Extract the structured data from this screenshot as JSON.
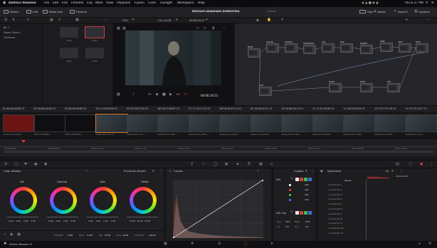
{
  "menubar": {
    "app": "DaVinci Resolve",
    "items": [
      "File",
      "Edit",
      "Trim",
      "Timeline",
      "Clip",
      "Mark",
      "View",
      "Playback",
      "Fusion",
      "Color",
      "Fairlight",
      "Workspace",
      "Help"
    ],
    "clock": "Thu 6:37 PM"
  },
  "toolbar": {
    "gallery": "Gallery",
    "luts": "LUTs",
    "media_pool": "Media Pool",
    "timeline": "Timeline",
    "project_title": "RESOLVE AVANZADO DOMESTIKA",
    "project_status": "Edited",
    "clips": "Clips",
    "nodes": "Nodes",
    "openfx": "OpenFX",
    "lightbox": "Lightbox"
  },
  "subbar": {
    "zoom": "37%",
    "clip_name": "Co1_OLOR",
    "timecode": "00:00:19:21"
  },
  "bins": [
    "Bin 1",
    "Power Grade 1",
    "Timelines"
  ],
  "thumbs": [
    "1401",
    "1401",
    "1401",
    "1401"
  ],
  "viewer": {
    "timecode": "00:00:19:21"
  },
  "nodes": {
    "labels": [
      "BASE",
      "COLOR",
      "CURVAS",
      "CONTRAST",
      "SAT",
      "HUE",
      "RANGE",
      "SKIN",
      "DET",
      "FACE",
      "CLIP",
      "LIGHT",
      "EXPO",
      "WB"
    ]
  },
  "timeline": {
    "clip_codes": [
      {
        "n": "01",
        "tc": "00:00:00:00",
        "tr": "V1"
      },
      {
        "n": "02",
        "tc": "00:00:00:00",
        "tr": "V1"
      },
      {
        "n": "03",
        "tc": "00:00:00:00",
        "tr": "V1"
      },
      {
        "n": "04",
        "tc": "11:20:00:00",
        "tr": "V1"
      },
      {
        "n": "05",
        "tc": "20:59:57:04",
        "tr": "V1"
      },
      {
        "n": "06",
        "tc": "16:27:08:07",
        "tr": "V1"
      },
      {
        "n": "07",
        "tc": "17:10:11:22",
        "tr": "V1"
      },
      {
        "n": "08",
        "tc": "16:45:03:14",
        "tr": "V1"
      },
      {
        "n": "09",
        "tc": "16:28:02:21",
        "tr": "V1"
      },
      {
        "n": "10",
        "tc": "16:46:30:14",
        "tr": "V1"
      },
      {
        "n": "11",
        "tc": "17:12:20:08",
        "tr": "V1"
      },
      {
        "n": "12",
        "tc": "16:29:09:09",
        "tr": "V1"
      },
      {
        "n": "13",
        "tc": "13:27:27:18",
        "tr": "V1"
      },
      {
        "n": "14",
        "tc": "15:17:19:17",
        "tr": "V1"
      }
    ],
    "clip_labels": [
      "Universal Countdo...",
      "SIH13 COLOR01...",
      "SIH13 COLOR02...",
      "Sw09_2017-10-17...",
      "Sw09_2017-10-1...",
      "Sw09_0714_2018...",
      "Sw09_0714_2018-...",
      "Sw09_0714_2018...",
      "Sw09_0721_2018...",
      "Sw09_0721_2018...",
      "Sw09_0721_2018-...",
      "Sw09_0721_2018-...",
      "Sw09_0721_2018-...",
      "Sw09_2017_10-1..."
    ],
    "ruler_ticks": [
      "00:00:00:00",
      "00:00:09:24",
      "00:00:17:16",
      "00:00:27:14",
      "00:00:37:02",
      "00:00:44:21",
      "00:00:53:00",
      "00:01:01:19",
      "00:01:09:18",
      "00:01:19:07"
    ]
  },
  "color_wheels": {
    "title": "Color Wheels",
    "primaries": "Primaries Wheels",
    "wheels": [
      {
        "name": "Lift",
        "vals": [
          "0.00",
          "0.00",
          "0.00",
          "0.00"
        ]
      },
      {
        "name": "Gamma",
        "vals": [
          "0.00",
          "0.00",
          "0.00",
          "0.00"
        ]
      },
      {
        "name": "Gain",
        "vals": [
          "1.00",
          "1.00",
          "1.00",
          "1.00"
        ]
      },
      {
        "name": "Offset",
        "vals": [
          "25.00",
          "25.00",
          "25.00"
        ]
      }
    ],
    "footer": {
      "contrast_label": "Contrast",
      "contrast": "1.000",
      "pivot_label": "Pivot",
      "pivot": "0.435",
      "sat_label": "Sat",
      "sat": "50.00",
      "hue_label": "Hue",
      "hue": "50.00",
      "lum_label": "Lum Mix",
      "lum": "100.00"
    }
  },
  "curves": {
    "title": "Curves"
  },
  "custom": {
    "title": "Custom",
    "edit": "Edit",
    "values": [
      "100",
      "100",
      "100",
      "100"
    ],
    "soft_clip": "Soft Clip",
    "low_label": "Low",
    "low": "50.0",
    "high_label": "High",
    "high": "50.0",
    "ls_label": "L.S.",
    "ls": "0.0",
    "hs_label": "H.S.",
    "hs": "0.0"
  },
  "keyframes": {
    "title": "Keyframes",
    "scope": "All",
    "master": "Master",
    "rows": [
      "Corrector 1",
      "Corrector 2",
      "Corrector 3",
      "Corrector 4",
      "Corrector 5",
      "Corrector 6",
      "Corrector 7",
      "Corrector 8",
      "Corrector 9",
      "Corrector 10",
      "Corrector 11"
    ],
    "time1": "00:00:00:00",
    "time2": "00:00:12:22"
  },
  "bottom": {
    "app": "DaVinci Resolve 15"
  },
  "colors": {
    "accent": "#d33a3a",
    "wheel_bg": "#1f1f22"
  }
}
